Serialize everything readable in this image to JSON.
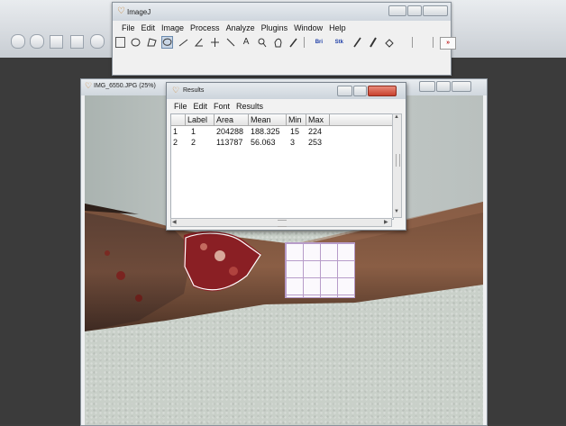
{
  "imagej": {
    "title": "ImageJ",
    "menu": [
      "File",
      "Edit",
      "Image",
      "Process",
      "Analyze",
      "Plugins",
      "Window",
      "Help"
    ],
    "tools": [
      "rectangle-tool",
      "oval-tool",
      "polygon-tool",
      "freehand-tool",
      "line-tool",
      "angle-tool",
      "point-tool",
      "wand-tool",
      "text-tool",
      "magnifier-tool",
      "hand-tool",
      "dropper-tool",
      "brightness-tool",
      "stacks-tool",
      "pencil-tool",
      "brush-tool",
      "flood-fill-tool",
      "more-tools"
    ],
    "tool_labels": {
      "text": "A",
      "brightness": "Bri",
      "stacks": "Stk",
      "more": "»"
    }
  },
  "image_window": {
    "title": "IMG_6550.JPG (25%)"
  },
  "results": {
    "title": "Results",
    "menu": [
      "File",
      "Edit",
      "Font",
      "Results"
    ],
    "columns": [
      "",
      "Label",
      "Area",
      "Mean",
      "Min",
      "Max"
    ],
    "rows": [
      {
        "index": "1",
        "label": "1",
        "area": "204288",
        "mean": "188.325",
        "min": "15",
        "max": "224"
      },
      {
        "index": "2",
        "label": "2",
        "area": "113787",
        "mean": "56.063",
        "min": "3",
        "max": "253"
      }
    ]
  },
  "colors": {
    "wound": "#8a1f24",
    "selection": "#ffffff",
    "skin": "#4a3329",
    "fabric": "#c9d0c9",
    "close_button": "#c8412e"
  }
}
